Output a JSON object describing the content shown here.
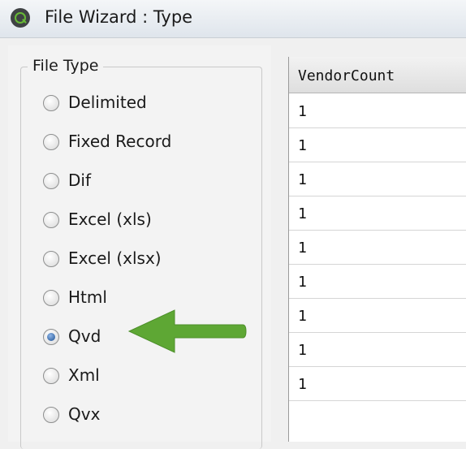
{
  "window": {
    "title": "File Wizard : Type"
  },
  "file_type": {
    "legend": "File Type",
    "options": [
      "Delimited",
      "Fixed Record",
      "Dif",
      "Excel (xls)",
      "Excel (xlsx)",
      "Html",
      "Qvd",
      "Xml",
      "Qvx"
    ],
    "selected": "Qvd"
  },
  "annotation": {
    "arrow_color": "#5ea734",
    "points_to": "Qvd"
  },
  "preview": {
    "column_header": "VendorCount",
    "rows": [
      "1",
      "1",
      "1",
      "1",
      "1",
      "1",
      "1",
      "1",
      "1"
    ]
  }
}
